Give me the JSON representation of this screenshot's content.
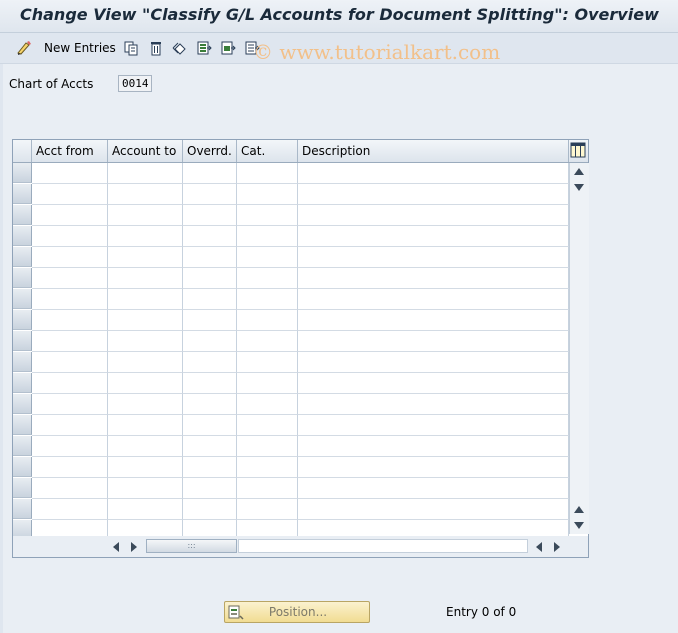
{
  "window": {
    "title": "Change View \"Classify G/L Accounts for Document Splitting\": Overview"
  },
  "toolbar": {
    "new_entries_label": "New Entries",
    "icons": [
      "edit-toggle-icon",
      "copy-icon",
      "delete-icon",
      "undo-icon",
      "select-all-icon",
      "select-block-icon",
      "deselect-all-icon"
    ]
  },
  "watermark": "© www.tutorialkart.com",
  "header_fields": {
    "chart_of_accts_label": "Chart of Accts",
    "chart_of_accts_value": "0014"
  },
  "table": {
    "columns": [
      "Acct from",
      "Account to",
      "Overrd.",
      "Cat.",
      "Description"
    ],
    "rows": [],
    "empty_row_count": 18
  },
  "footer": {
    "position_button_label": "Position...",
    "entry_text": "Entry 0 of 0"
  },
  "colors": {
    "background": "#dfe6ef",
    "title_text": "#1a2a3a",
    "position_button": "#f1dc92"
  }
}
